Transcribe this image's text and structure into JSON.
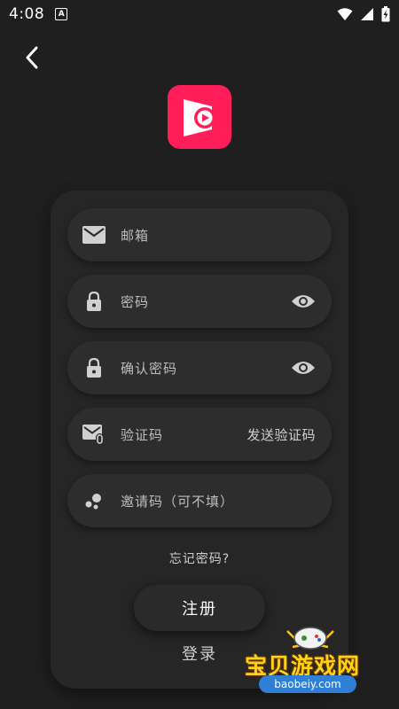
{
  "status_bar": {
    "time": "4:08",
    "notification_glyph": "A",
    "icons": [
      "wifi-icon",
      "signal-icon",
      "battery-icon"
    ]
  },
  "header": {
    "back_icon": "chevron-left-icon"
  },
  "app": {
    "logo_icon": "video-play-logo-icon",
    "brand_color": "#ff1e5a"
  },
  "form": {
    "email": {
      "icon": "mail-icon",
      "placeholder": "邮箱"
    },
    "password": {
      "icon": "lock-icon",
      "placeholder": "密码",
      "right_icon": "eye-icon"
    },
    "confirm_password": {
      "icon": "lock-icon",
      "placeholder": "确认密码",
      "right_icon": "eye-icon"
    },
    "verification_code": {
      "icon": "mail-attach-icon",
      "placeholder": "验证码",
      "send_label": "发送验证码"
    },
    "invite_code": {
      "icon": "dots-icon",
      "placeholder": "邀请码（可不填）"
    }
  },
  "forgot_password": "忘记密码?",
  "register_label": "注册",
  "login_label": "登录",
  "watermark": {
    "title": "宝贝游戏网",
    "url": "baobeiy.com"
  }
}
